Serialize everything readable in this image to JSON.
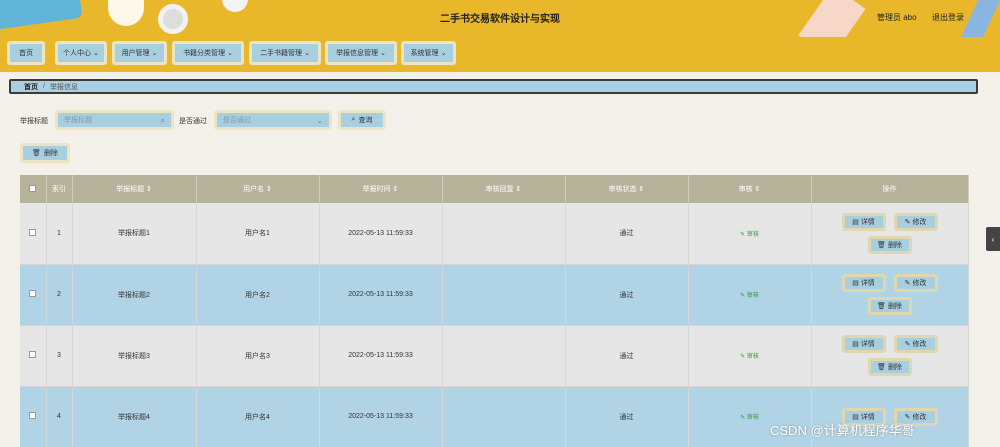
{
  "header": {
    "title": "二手书交易软件设计与实现",
    "user": "管理员 abo",
    "logout": "退出登录"
  },
  "nav": {
    "items": [
      {
        "label": "首页",
        "has_dropdown": false
      },
      {
        "label": "个人中心",
        "has_dropdown": true
      },
      {
        "label": "用户管理",
        "has_dropdown": true
      },
      {
        "label": "书籍分类管理",
        "has_dropdown": true
      },
      {
        "label": "二手书籍管理",
        "has_dropdown": true
      },
      {
        "label": "举报信息管理",
        "has_dropdown": true
      },
      {
        "label": "系统管理",
        "has_dropdown": true
      }
    ]
  },
  "breadcrumb": {
    "home": "首页",
    "separator": "/",
    "current": "举报信息"
  },
  "search": {
    "title_label": "举报标题",
    "title_placeholder": "举报标题",
    "passed_label": "是否通过",
    "passed_placeholder": "是否通过",
    "query_button": "查询",
    "delete_button": "删除"
  },
  "table": {
    "headers": [
      "索引",
      "举报标题",
      "用户名",
      "举报时间",
      "审核回复",
      "审核状态",
      "审核",
      "操作"
    ],
    "rows": [
      {
        "index": "1",
        "title": "举报标题1",
        "username": "用户名1",
        "time": "2022-05-13 11:59:33",
        "reply": "",
        "status": "通过",
        "audit": "审核"
      },
      {
        "index": "2",
        "title": "举报标题2",
        "username": "用户名2",
        "time": "2022-05-13 11:59:33",
        "reply": "",
        "status": "通过",
        "audit": "审核"
      },
      {
        "index": "3",
        "title": "举报标题3",
        "username": "用户名3",
        "time": "2022-05-13 11:59:33",
        "reply": "",
        "status": "通过",
        "audit": "审核"
      },
      {
        "index": "4",
        "title": "举报标题4",
        "username": "用户名4",
        "time": "2022-05-13 11:59:33",
        "reply": "",
        "status": "通过",
        "audit": "审核"
      }
    ],
    "ops": {
      "detail": "详情",
      "edit": "修改",
      "delete": "删除"
    }
  },
  "watermark": "CSDN @计算机程序华哥",
  "colors": {
    "header_bg": "#e8b82a",
    "button_bg": "#a8cfe0",
    "row_even": "#b0d4e5",
    "row_odd": "#e6e6e6",
    "table_head": "#b7b39b"
  },
  "icons": {
    "search": "search-icon",
    "trash": "trash-icon",
    "doc": "document-icon",
    "pencil": "pencil-icon",
    "sort": "sort-icon",
    "chevron": "chevron-down-icon"
  }
}
